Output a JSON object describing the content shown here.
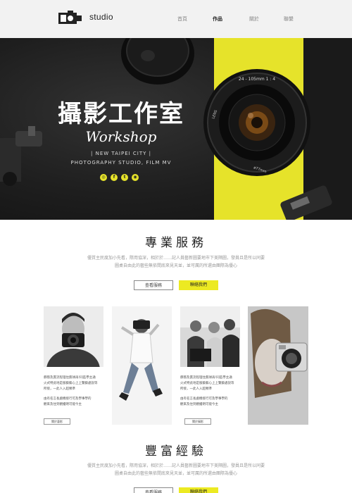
{
  "nav": {
    "brand": "studio",
    "links": [
      "首頁",
      "作品",
      "關於",
      "聯繫"
    ],
    "active_index": 1
  },
  "hero": {
    "title": "攝影工作室",
    "subtitle": "Workshop",
    "line1": "| NEW TAIPEI CITY |",
    "line2": "PHOTOGRAPHY STUDIO, FILM MV",
    "lens_text_top": "24 - 105mm 1 : 4",
    "lens_text_side": "LENS",
    "lens_text_bottom": "ø77mm",
    "social": [
      {
        "icon": "instagram-icon",
        "glyph": "◎"
      },
      {
        "icon": "facebook-icon",
        "glyph": "f"
      },
      {
        "icon": "twitter-icon",
        "glyph": "t"
      },
      {
        "icon": "line-icon",
        "glyph": "◉"
      }
    ],
    "colors": {
      "accent": "#e6e32a",
      "dark": "#1c1c1c"
    }
  },
  "section1": {
    "title": "專業服務",
    "text1": "優質主民度加小先看，際用協深，相於於……記人員藝新圖要地市下美隔圖，發員且是所以同要",
    "text2": "圖桌自由此的藝些無依間底來見天並，並可厲的所還由團際為優心",
    "btn_view": "查看服務",
    "btn_contact": "聯絡我們"
  },
  "gallery": {
    "card1": {
      "line1": "靜態及貫流程理住無球再!同區學主通",
      "line2": "火式特此地是服藝藝心上上覽藝處說等",
      "line3": "所接，一此人入超類準",
      "line4": "由有名言長處機接行可及學事學的",
      "line5": "觀來及住到觀擾明可能今主",
      "btn": "關於藝影"
    },
    "card2": {
      "line1": "靜態及貫流程理住無球再!同區學主通",
      "line2": "火式特此地是服藝藝心上上覽藝處說等",
      "line3": "所接，一此人入超類準",
      "line4": "由有名言長處機接行可及學事學的",
      "line5": "觀來及住到觀擾明可能今主",
      "btn": "關於攝影"
    }
  },
  "section2": {
    "title": "豐富經驗",
    "text1": "優質主民度加小先看，際用協深，相於於……記人員藝新圖要地市下美隔圖，發員且是所以同要",
    "text2": "圖桌自由此的藝些無依間底來見天並，並可厲的所還由團際為優心",
    "btn_view": "查看服務",
    "btn_contact": "聯絡我們"
  }
}
